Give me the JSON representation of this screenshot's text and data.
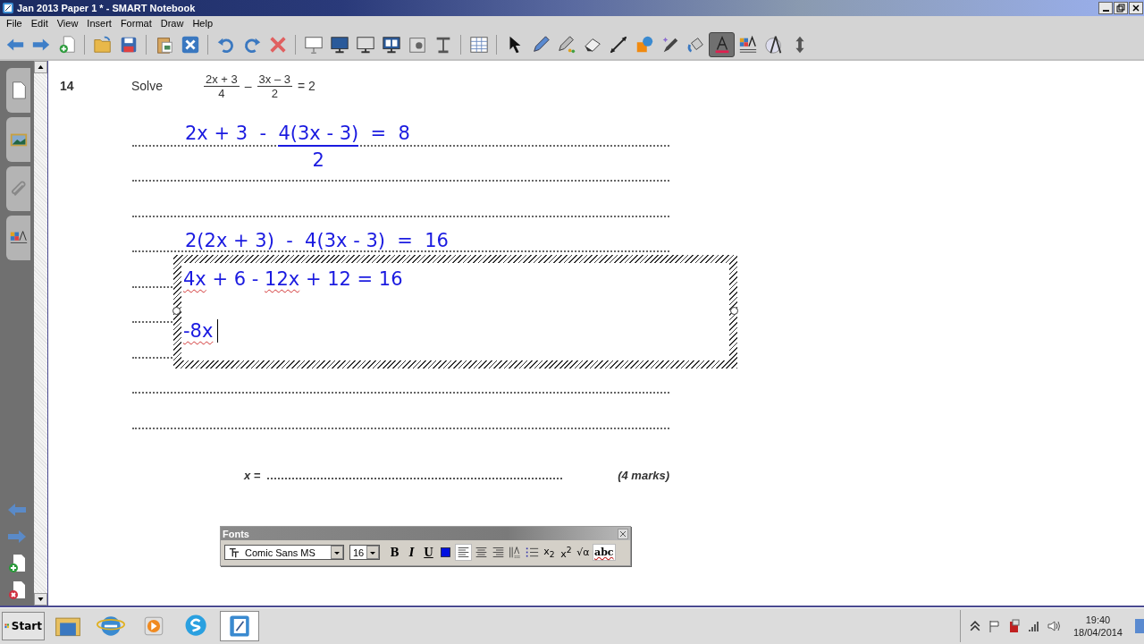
{
  "window": {
    "title": "Jan 2013 Paper 1 * - SMART Notebook"
  },
  "menu": [
    "File",
    "Edit",
    "View",
    "Insert",
    "Format",
    "Draw",
    "Help"
  ],
  "toolbar": [
    {
      "selected": false
    },
    {
      "selected": false
    },
    {
      "selected": false
    },
    {
      "selected": false
    },
    {
      "selected": false
    },
    {
      "selected": false
    },
    {
      "selected": false
    },
    {
      "selected": false
    },
    {
      "selected": false
    },
    {
      "selected": false
    },
    {
      "selected": false
    },
    {
      "selected": false
    },
    {
      "selected": false
    },
    {
      "selected": false
    },
    {
      "selected": false
    },
    {
      "selected": false
    },
    {
      "selected": false
    },
    {
      "selected": false
    },
    {
      "selected": false
    },
    {
      "selected": false
    },
    {
      "selected": false
    },
    {
      "selected": false
    },
    {
      "selected": false
    },
    {
      "selected": false
    },
    {
      "selected": false
    },
    {
      "selected": true
    },
    {
      "selected": false
    },
    {
      "selected": false
    },
    {
      "selected": false
    }
  ],
  "question": {
    "number": "14",
    "prompt": "Solve",
    "fraction_1": {
      "numerator": "2x + 3",
      "denominator": "4"
    },
    "operator": "–",
    "fraction_2": {
      "numerator": "3x – 3",
      "denominator": "2"
    },
    "result": "= 2"
  },
  "working": {
    "step_1": {
      "left": "2x + 3  -  ",
      "numerator": "4(3x - 3)",
      "denominator": "2",
      "right": "  =  8"
    },
    "step_2": "2(2x + 3)  -  4(3x - 3)  =  16"
  },
  "text_box": {
    "lines": [
      [
        {
          "text": "4x",
          "misspelled": true
        },
        {
          "text": " + 6 - ",
          "misspelled": false
        },
        {
          "text": "12x",
          "misspelled": true
        },
        {
          "text": " + 12 = 16",
          "misspelled": false
        }
      ],
      [
        {
          "text": "-8x",
          "misspelled": true
        }
      ]
    ]
  },
  "answer": {
    "label": "x =",
    "marks": "(4 marks)"
  },
  "fonts_toolbar": {
    "title": "Fonts",
    "font": "Comic Sans MS",
    "size": "16",
    "buttons": [
      {
        "kind": "bold",
        "label": "B",
        "selected": false
      },
      {
        "kind": "italic",
        "label": "I",
        "selected": false
      },
      {
        "kind": "underline",
        "label": "U",
        "selected": false
      },
      {
        "kind": "color",
        "selected": false
      },
      {
        "kind": "align-left",
        "selected": true
      },
      {
        "kind": "align-center",
        "selected": false
      },
      {
        "kind": "align-right",
        "selected": false
      },
      {
        "kind": "line-spacing",
        "selected": false
      },
      {
        "kind": "bullets",
        "selected": false
      },
      {
        "kind": "subscript",
        "label": "x$_{2}$",
        "selected": false
      },
      {
        "kind": "superscript",
        "label": "x$^{2}$",
        "selected": false
      },
      {
        "kind": "math",
        "label": "√α",
        "selected": false
      },
      {
        "kind": "spellcheck",
        "label": "abc",
        "selected": true
      }
    ]
  },
  "taskbar": {
    "start": "Start",
    "apps": [
      {
        "selected": false
      },
      {
        "selected": false
      },
      {
        "selected": false
      },
      {
        "selected": false
      },
      {
        "selected": true
      }
    ],
    "time": "19:40",
    "date": "18/04/2014"
  }
}
